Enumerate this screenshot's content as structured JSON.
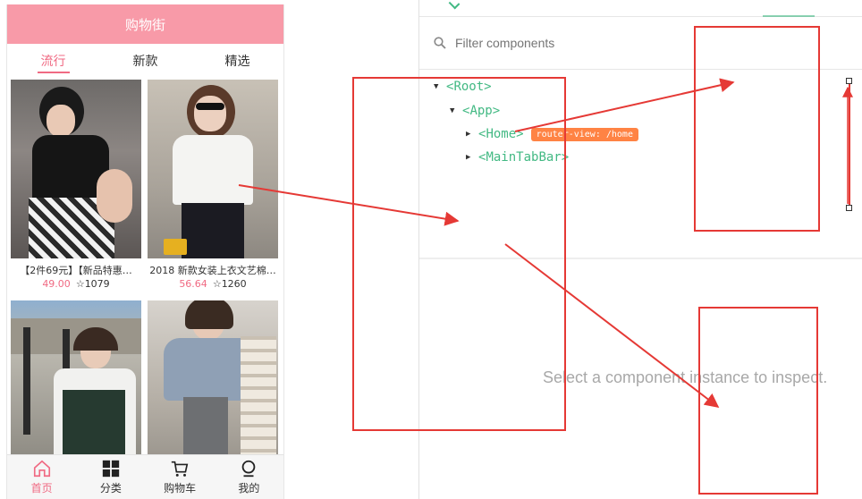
{
  "app": {
    "navbar_title": "购物街",
    "tabs": [
      {
        "label": "流行",
        "active": true
      },
      {
        "label": "新款",
        "active": false
      },
      {
        "label": "精选",
        "active": false
      }
    ],
    "goods": [
      {
        "title": "【2件69元】【新品特惠…",
        "price": "49.00",
        "collect": "1079"
      },
      {
        "title": "2018 新款女装上衣文艺棉…",
        "price": "56.64",
        "collect": "1260"
      },
      {
        "title": "",
        "price": "",
        "collect": ""
      },
      {
        "title": "",
        "price": "",
        "collect": ""
      }
    ],
    "tabbar": [
      {
        "label": "首页",
        "icon": "home-icon",
        "active": true
      },
      {
        "label": "分类",
        "icon": "category-icon",
        "active": false
      },
      {
        "label": "购物车",
        "icon": "cart-icon",
        "active": false
      },
      {
        "label": "我的",
        "icon": "profile-icon",
        "active": false
      }
    ],
    "colors": {
      "accent": "#f06a83",
      "navbar": "#f89aa8"
    }
  },
  "devtools": {
    "filter_placeholder": "Filter components",
    "tree": [
      {
        "tag": "Root",
        "depth": 0,
        "expanded": true
      },
      {
        "tag": "App",
        "depth": 1,
        "expanded": true
      },
      {
        "tag": "Home",
        "depth": 2,
        "expanded": false,
        "badge": "router-view: /home"
      },
      {
        "tag": "MainTabBar",
        "depth": 2,
        "expanded": false
      }
    ],
    "empty_message": "Select a component instance to inspect.",
    "colors": {
      "tag": "#42b983",
      "badge": "#ff8344",
      "annotation": "#e53935"
    }
  }
}
